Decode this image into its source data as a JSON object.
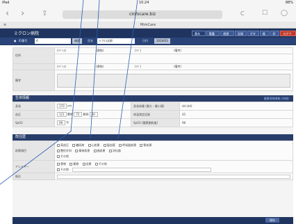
{
  "statusbar": {
    "carrier": "iPad",
    "time": "10:24",
    "battery": "88%"
  },
  "browser": {
    "url": "cinfocare.biz",
    "tab_title": "MimCare",
    "back_icon": "back-chevron-icon",
    "forward_icon": "forward-chevron-icon",
    "share_icon": "share-icon",
    "reload_icon": "reload-icon"
  },
  "app": {
    "title": "ミクロン病院",
    "top_buttons": [
      "基本情報",
      "看護記録",
      "経過記録",
      "記録簿",
      "ボタン",
      "検索",
      "印刷",
      "ログアウト"
    ],
    "patient_label": "ID番号",
    "patient_value": "4",
    "patient_btn": "検索",
    "name_label": "氏名",
    "name_value": "ミクロ太郎",
    "date_label": "日付",
    "date_value": "2024/03"
  },
  "upper_section": {
    "address_label": "住所",
    "row_values": [
      "(ｱﾄﾞﾚｽ)",
      "(建物)",
      "(ｱﾄﾞ)",
      "(備考)"
    ],
    "remarks_label": "備考"
  },
  "vitals": {
    "title": "生体情報",
    "link": "健康保険情報 (詳細)",
    "height_label": "身長",
    "height_value": "170",
    "height_unit": "cm",
    "bp_label": "血圧",
    "bp_value": "121",
    "bp_high_label": "最高",
    "bp_low_label": "最低",
    "bp_low_value": "75",
    "pulse_value": "80",
    "pulse_label": "脈拍",
    "spo2_label": "SpO2",
    "spo2_value": "98",
    "spo2_unit": "%",
    "right_rows": [
      {
        "label": "身長体重 (最大・最小値)",
        "value": "dd (dd)"
      },
      {
        "label": "体温測定記録",
        "value": "45"
      },
      {
        "label": "SpO2 (酸素飽和度)",
        "value": "98"
      }
    ]
  },
  "history": {
    "title": "既往歴",
    "disease_label": "疾患項目",
    "disease_options_row1": [
      "高血圧",
      "糖尿病",
      "心疾患",
      "脳血管",
      "呼吸器疾患",
      "腎疾患"
    ],
    "disease_options_row2": [
      "整形外科",
      "精神疾患",
      "癌疾患",
      "消化器"
    ],
    "disease_options_row3": [
      "その他"
    ],
    "allergy_label": "アレルギー",
    "allergy_options": [
      "食物",
      "薬物",
      "金属",
      "その他"
    ],
    "allergy_other": "その他",
    "other_label": "既往"
  },
  "footer": {
    "button": "保存"
  }
}
